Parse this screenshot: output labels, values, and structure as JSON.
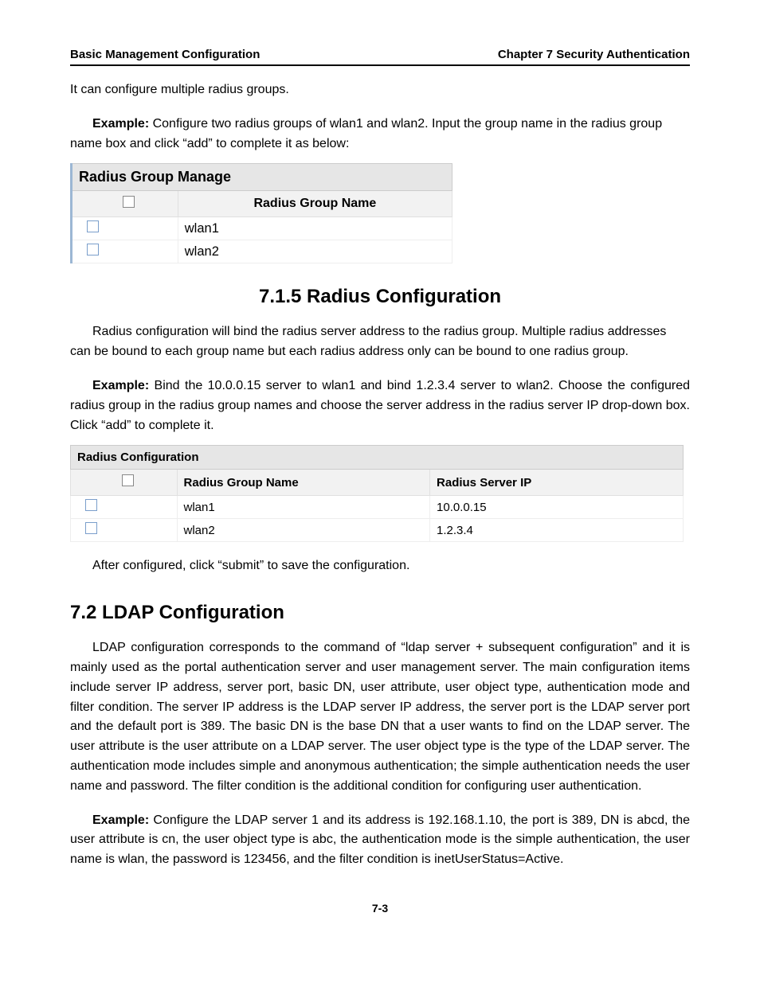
{
  "header": {
    "left": "Basic Management Configuration",
    "right": "Chapter 7 Security Authentication"
  },
  "intro1": "It can configure multiple radius groups.",
  "example1_label": "Example:",
  "example1_text": " Configure two radius groups of wlan1 and wlan2. Input the group name in the radius group name box and click “add” to complete it as below:",
  "table1": {
    "title": "Radius Group Manage",
    "col_header": "Radius Group Name",
    "rows": [
      "wlan1",
      "wlan2"
    ]
  },
  "section715_heading": "7.1.5 Radius Configuration",
  "section715_para": "Radius configuration will bind the radius server address to the radius group. Multiple radius addresses can be bound to each group name but each radius address only can be bound to one radius group.",
  "example2_label": "Example:",
  "example2_text": " Bind the 10.0.0.15 server to wlan1 and bind 1.2.3.4 server to wlan2. Choose the configured radius group in the radius group names and choose the server address in the radius server IP drop-down box. Click “add” to complete it.",
  "table2": {
    "title": "Radius Configuration",
    "col1": "Radius Group Name",
    "col2": "Radius Server IP",
    "rows": [
      {
        "name": "wlan1",
        "ip": "10.0.0.15"
      },
      {
        "name": "wlan2",
        "ip": "1.2.3.4"
      }
    ]
  },
  "after_t2": "After configured, click “submit” to save the configuration.",
  "section72_heading": "7.2 LDAP Configuration",
  "section72_para": "LDAP configuration corresponds to the command of “ldap server + subsequent configuration” and it is mainly used as the portal authentication server and user management server. The main configuration items include server IP address, server port, basic DN, user attribute, user object type, authentication mode and filter condition. The server IP address is the LDAP server IP address, the server port is the LDAP server port and the default port is 389. The basic DN is the base DN that a user wants to find on the LDAP server. The user attribute is the user attribute on a LDAP server. The user object type is the type of the LDAP server. The authentication mode includes simple and anonymous authentication; the simple authentication needs the user name and password. The filter condition is the additional condition for configuring user authentication.",
  "example3_label": "Example:",
  "example3_text": " Configure the LDAP server 1 and its address is 192.168.1.10, the port is 389, DN is abcd, the user attribute is cn, the user object type is abc, the authentication mode is the simple authentication, the user name is wlan, the password is 123456, and the filter condition is inetUserStatus=Active.",
  "footer": "7-3"
}
